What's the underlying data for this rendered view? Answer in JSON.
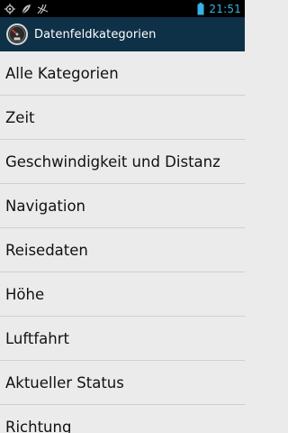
{
  "status_bar": {
    "time": "21:51",
    "icons": [
      "gps-icon",
      "leaf-icon",
      "signal-icon",
      "battery-icon"
    ]
  },
  "action_bar": {
    "title": "Datenfeldkategorien",
    "icon": "speedometer-app-icon"
  },
  "list": {
    "items": [
      {
        "label": "Alle Kategorien"
      },
      {
        "label": "Zeit"
      },
      {
        "label": "Geschwindigkeit und Distanz"
      },
      {
        "label": "Navigation"
      },
      {
        "label": "Reisedaten"
      },
      {
        "label": "Höhe"
      },
      {
        "label": "Luftfahrt"
      },
      {
        "label": "Aktueller Status"
      },
      {
        "label": "Richtung"
      }
    ]
  },
  "colors": {
    "status_bar_bg": "#000000",
    "action_bar_bg": "#0f3148",
    "time_color": "#33b5e5",
    "list_bg": "#ebebeb",
    "divider": "#cfcfcf"
  }
}
